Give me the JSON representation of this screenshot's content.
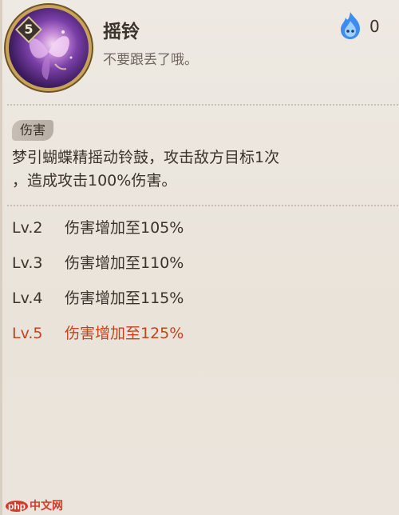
{
  "skill": {
    "level": "5",
    "name": "摇铃",
    "quote": "不要跟丢了哦。",
    "cost": "0"
  },
  "tag": "伤害",
  "description": {
    "line1": "梦引蝴蝶精摇动铃鼓，攻击敌方目标1次",
    "line2": "，造成攻击100%伤害。"
  },
  "levels": [
    {
      "lv": "Lv.2",
      "text": "伤害增加至105%"
    },
    {
      "lv": "Lv.3",
      "text": "伤害增加至110%"
    },
    {
      "lv": "Lv.4",
      "text": "伤害增加至115%"
    },
    {
      "lv": "Lv.5",
      "text": "伤害增加至125%"
    }
  ],
  "watermark": {
    "logo": "php",
    "text": "中文网"
  },
  "colors": {
    "active_level": "#c0451f",
    "frame_gold": "#caa35a",
    "fire_blue": "#3d8df0"
  },
  "icons": {
    "skill": "butterfly-fairy-skill-icon",
    "cost": "ghost-fire-icon"
  }
}
